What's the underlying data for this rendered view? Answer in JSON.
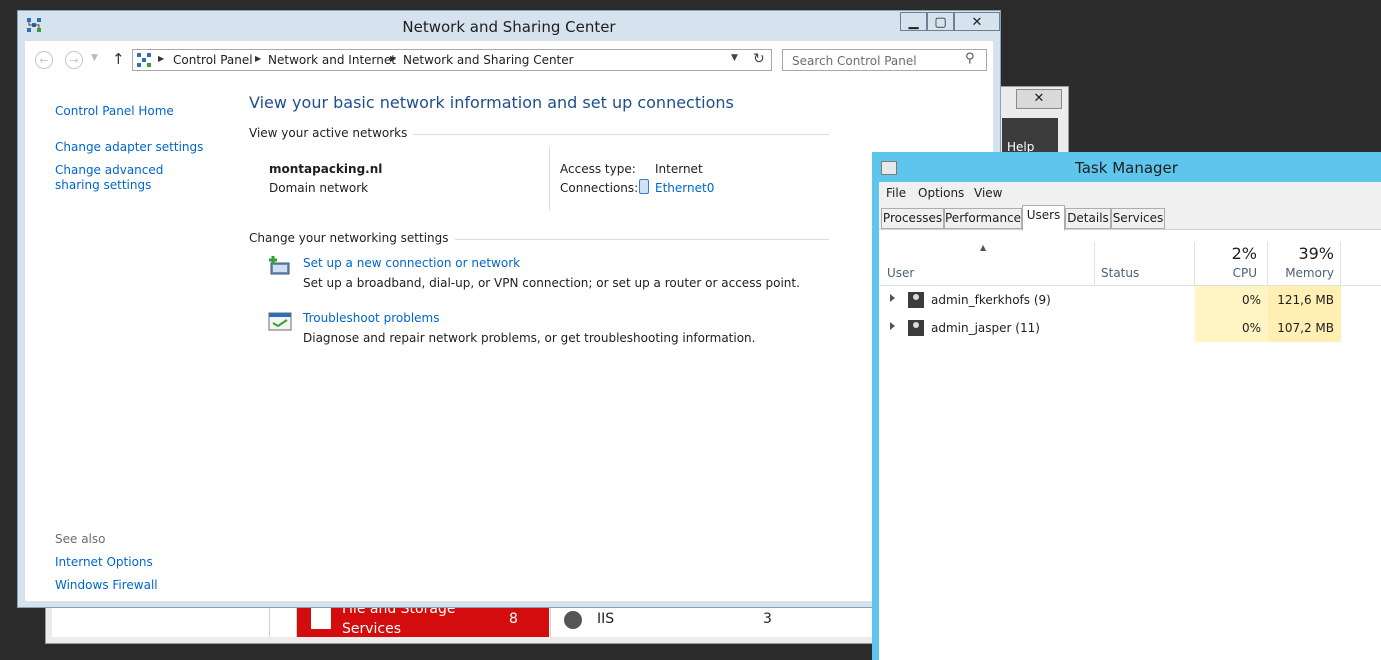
{
  "background_window": {
    "close_glyph": "✕",
    "help_label": "Help",
    "tiles": [
      {
        "title": "File and Storage Services",
        "count": "8"
      },
      {
        "title": "IIS",
        "count": "3"
      }
    ]
  },
  "nsc": {
    "title": "Network and Sharing Center",
    "address": {
      "crumbs": [
        "Control Panel",
        "Network and Internet",
        "Network and Sharing Center"
      ]
    },
    "search_placeholder": "Search Control Panel",
    "left_pane": {
      "home": "Control Panel Home",
      "links": [
        "Change adapter settings",
        "Change advanced sharing settings"
      ],
      "see_also": "See also",
      "see_also_links": [
        "Internet Options",
        "Windows Firewall"
      ]
    },
    "heading": "View your basic network information and set up connections",
    "active_label": "View your active networks",
    "network": {
      "name": "montapacking.nl",
      "type": "Domain network",
      "access_type_label": "Access type:",
      "access_type": "Internet",
      "connections_label": "Connections:",
      "connection": "Ethernet0"
    },
    "change_label": "Change your networking settings",
    "tasks": [
      {
        "title": "Set up a new connection or network",
        "desc": "Set up a broadband, dial-up, or VPN connection; or set up a router or access point."
      },
      {
        "title": "Troubleshoot problems",
        "desc": "Diagnose and repair network problems, or get troubleshooting information."
      }
    ]
  },
  "task_manager": {
    "title": "Task Manager",
    "menu": [
      "File",
      "Options",
      "View"
    ],
    "tabs": [
      "Processes",
      "Performance",
      "Users",
      "Details",
      "Services"
    ],
    "active_tab": "Users",
    "columns": {
      "user": "User",
      "status": "Status",
      "cpu": "CPU",
      "memory": "Memory"
    },
    "totals": {
      "cpu": "2%",
      "memory": "39%"
    },
    "rows": [
      {
        "user": "admin_fkerkhofs (9)",
        "status": "",
        "cpu": "0%",
        "memory": "121,6 MB"
      },
      {
        "user": "admin_jasper (11)",
        "status": "",
        "cpu": "0%",
        "memory": "107,2 MB"
      }
    ]
  },
  "icons": {
    "window_min": "minimize-icon",
    "window_max": "maximize-icon",
    "window_close": "close-icon"
  },
  "colors": {
    "link": "#0066cc",
    "heading": "#1e4e8c",
    "nsc_frame": "#d6e2ee",
    "taskmgr_frame": "#5ec6ec",
    "tile_red": "#d30d0d",
    "cpu_cell": "#fff4c4",
    "mem_cell": "#ffefb2"
  }
}
